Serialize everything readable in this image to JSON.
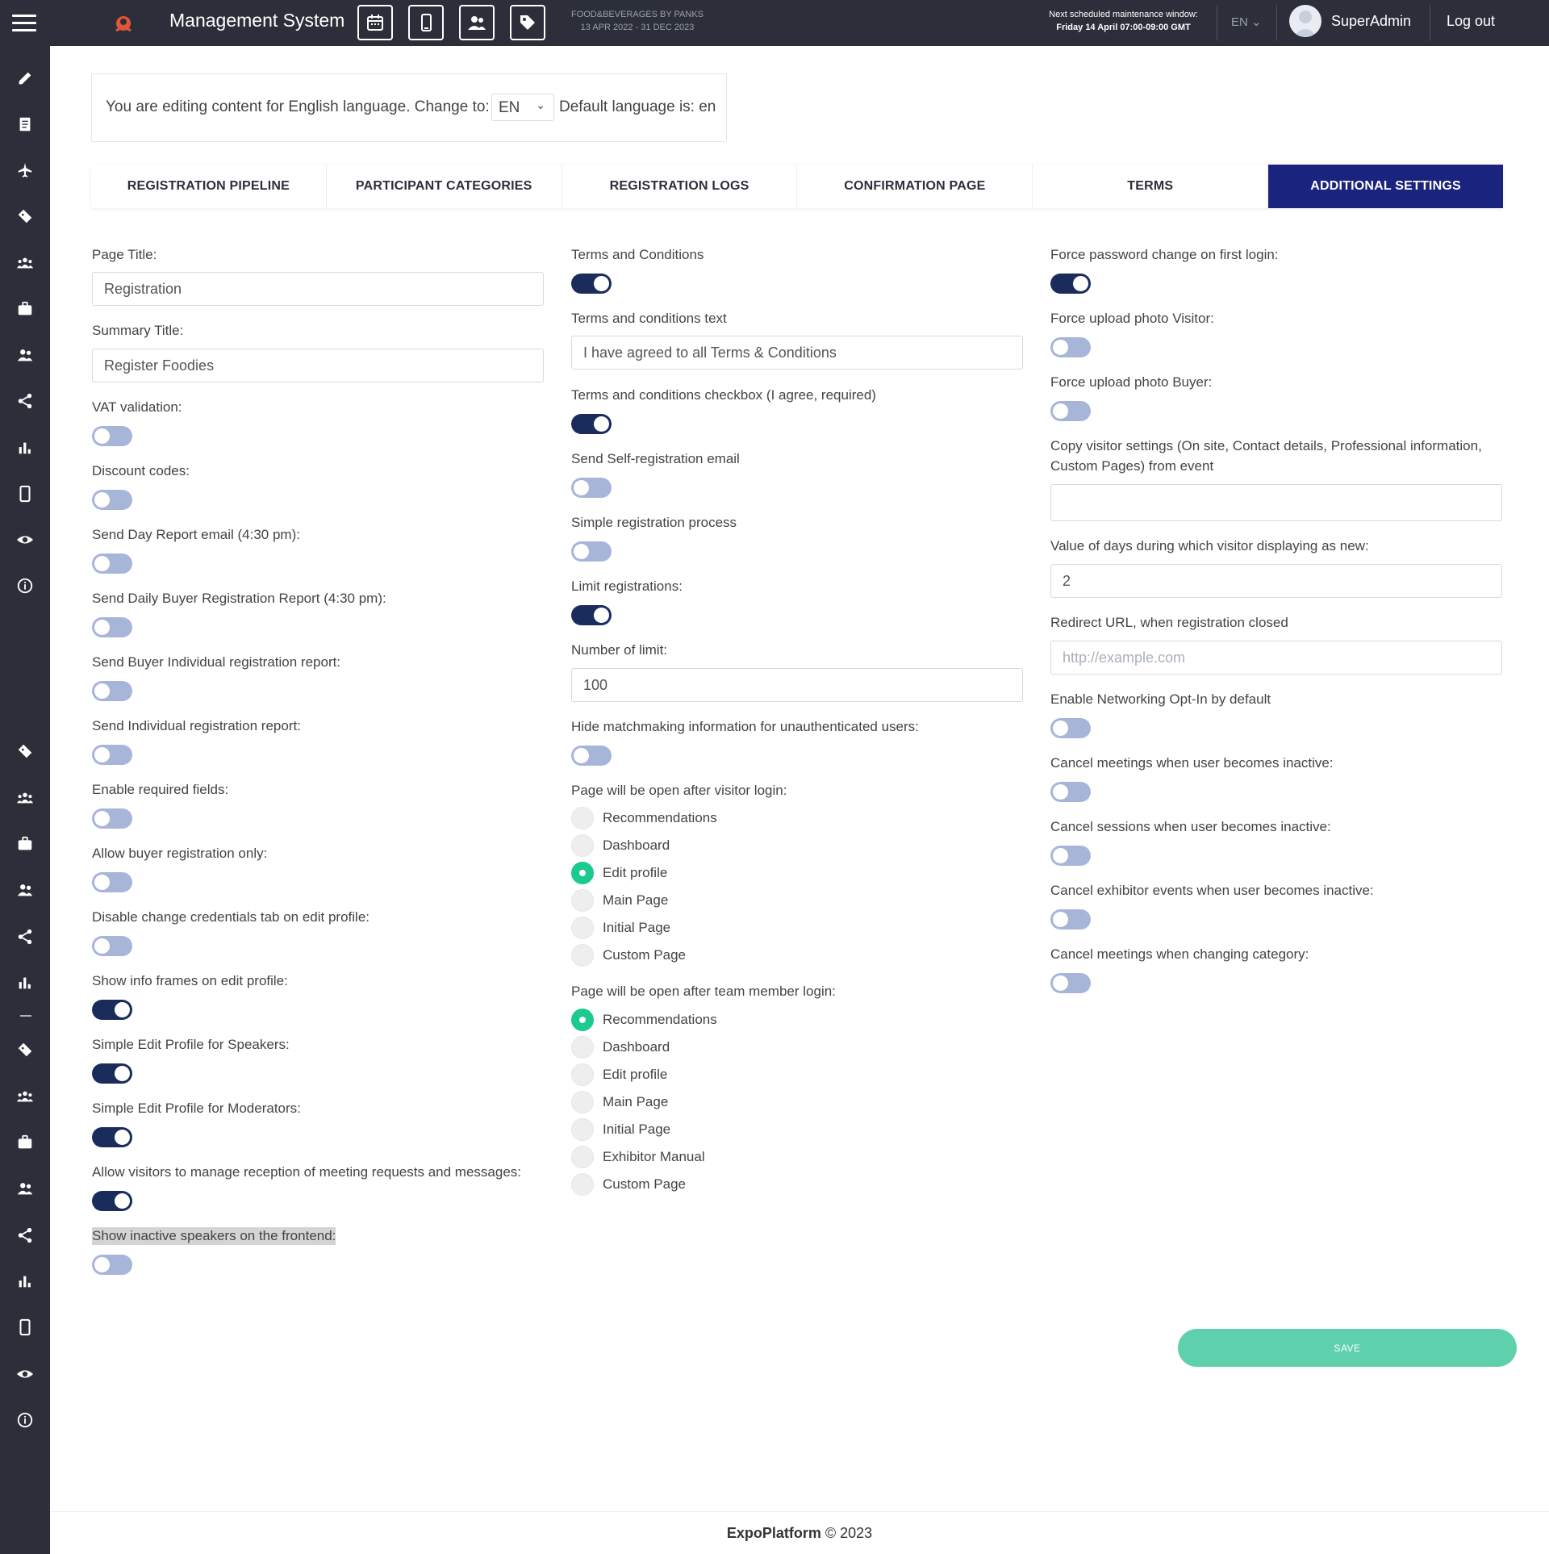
{
  "header": {
    "app_title": "Management System",
    "event_name": "FOOD&BEVERAGES BY PANKS",
    "event_dates": "13 APR 2022 - 31 DEC 2023",
    "maintenance_title": "Next scheduled maintenance window:",
    "maintenance_time": "Friday 14 April 07:00-09:00 GMT",
    "language": "EN",
    "user_name": "SuperAdmin",
    "logout_label": "Log out"
  },
  "language_bar": {
    "editing_text": "You are editing content for English language. Change to:",
    "selected": "EN",
    "default_text": "Default language is: en"
  },
  "tabs": [
    {
      "label": "REGISTRATION PIPELINE"
    },
    {
      "label": "PARTICIPANT CATEGORIES"
    },
    {
      "label": "REGISTRATION LOGS"
    },
    {
      "label": "CONFIRMATION PAGE"
    },
    {
      "label": "TERMS"
    },
    {
      "label": "ADDITIONAL SETTINGS"
    }
  ],
  "left": {
    "page_title_label": "Page Title:",
    "page_title_value": "Registration",
    "summary_title_label": "Summary Title:",
    "summary_title_value": "Register Foodies",
    "toggles": [
      {
        "label": "VAT validation:",
        "on": false
      },
      {
        "label": "Discount codes:",
        "on": false
      },
      {
        "label": "Send Day Report email (4:30 pm):",
        "on": false
      },
      {
        "label": "Send Daily Buyer Registration Report (4:30 pm):",
        "on": false
      },
      {
        "label": "Send Buyer Individual registration report:",
        "on": false
      },
      {
        "label": "Send Individual registration report:",
        "on": false
      },
      {
        "label": "Enable required fields:",
        "on": false
      },
      {
        "label": "Allow buyer registration only:",
        "on": false
      },
      {
        "label": "Disable change credentials tab on edit profile:",
        "on": false
      },
      {
        "label": "Show info frames on edit profile:",
        "on": true
      },
      {
        "label": "Simple Edit Profile for Speakers:",
        "on": true
      },
      {
        "label": "Simple Edit Profile for Moderators:",
        "on": true
      },
      {
        "label": "Allow visitors to manage reception of meeting requests and messages:",
        "on": true
      },
      {
        "label": "Show inactive speakers on the frontend:",
        "on": false
      }
    ]
  },
  "middle": {
    "terms_label": "Terms and Conditions",
    "terms_on": true,
    "terms_text_label": "Terms and conditions text",
    "terms_text_value": "I have agreed to all Terms & Conditions",
    "checkbox_label": "Terms and conditions checkbox (I agree, required)",
    "checkbox_on": true,
    "self_reg_label": "Send Self-registration email",
    "self_reg_on": false,
    "simple_reg_label": "Simple registration process",
    "simple_reg_on": false,
    "limit_label": "Limit registrations:",
    "limit_on": true,
    "number_label": "Number of limit:",
    "number_value": "100",
    "hide_label": "Hide matchmaking information for unauthenticated users:",
    "hide_on": false,
    "visitor_label": "Page will be open after visitor login:",
    "visitor_options": [
      {
        "label": "Recommendations",
        "selected": false
      },
      {
        "label": "Dashboard",
        "selected": false
      },
      {
        "label": "Edit profile",
        "selected": true
      },
      {
        "label": "Main Page",
        "selected": false
      },
      {
        "label": "Initial Page",
        "selected": false
      },
      {
        "label": "Custom Page",
        "selected": false
      }
    ],
    "team_label": "Page will be open after team member login:",
    "team_options": [
      {
        "label": "Recommendations",
        "selected": true
      },
      {
        "label": "Dashboard",
        "selected": false
      },
      {
        "label": "Edit profile",
        "selected": false
      },
      {
        "label": "Main Page",
        "selected": false
      },
      {
        "label": "Initial Page",
        "selected": false
      },
      {
        "label": "Exhibitor Manual",
        "selected": false
      },
      {
        "label": "Custom Page",
        "selected": false
      }
    ]
  },
  "right": {
    "force_pwd_label": "Force password change on first login:",
    "force_pwd_on": true,
    "photo_visitor_label": "Force upload photo Visitor:",
    "photo_visitor_on": false,
    "photo_buyer_label": "Force upload photo Buyer:",
    "photo_buyer_on": false,
    "copy_label": "Copy visitor settings (On site, Contact details, Professional information, Custom Pages) from event",
    "copy_value": "",
    "days_label": "Value of days during which visitor displaying as new:",
    "days_value": "2",
    "redirect_label": "Redirect URL, when registration closed",
    "redirect_placeholder": "http://example.com",
    "networking_label": "Enable Networking Opt-In by default",
    "networking_on": false,
    "cancel_meetings_label": "Cancel meetings when user becomes inactive:",
    "cancel_meetings_on": false,
    "cancel_sessions_label": "Cancel sessions when user becomes inactive:",
    "cancel_sessions_on": false,
    "cancel_exhibitor_label": "Cancel exhibitor events when user becomes inactive:",
    "cancel_exhibitor_on": false,
    "cancel_category_label": "Cancel meetings when changing category:",
    "cancel_category_on": false
  },
  "save_label": "SAVE",
  "footer": {
    "brand": "ExpoPlatform",
    "copyright": "© 2023"
  },
  "colors": {
    "nav_bg": "#2c2f3a",
    "active_tab": "#1a237e",
    "toggle_on": "#1a2c5b",
    "toggle_off": "#a7b5d8",
    "radio_selected": "#1cc98e",
    "save_button": "#5ed1ac"
  },
  "sidebar_icons": [
    "edit-icon",
    "list-icon",
    "plane-icon",
    "ticket-icon",
    "group-icon",
    "briefcase-icon",
    "people-icon",
    "share-icon",
    "chart-icon",
    "mobile-icon",
    "eye-icon",
    "info-icon",
    "ticket-icon",
    "group-icon",
    "briefcase-icon",
    "people-icon",
    "share-icon",
    "chart-icon",
    "ticket-icon",
    "group-icon",
    "briefcase-icon",
    "people-icon",
    "share-icon",
    "chart-icon",
    "mobile-icon",
    "eye-icon",
    "info-icon"
  ]
}
